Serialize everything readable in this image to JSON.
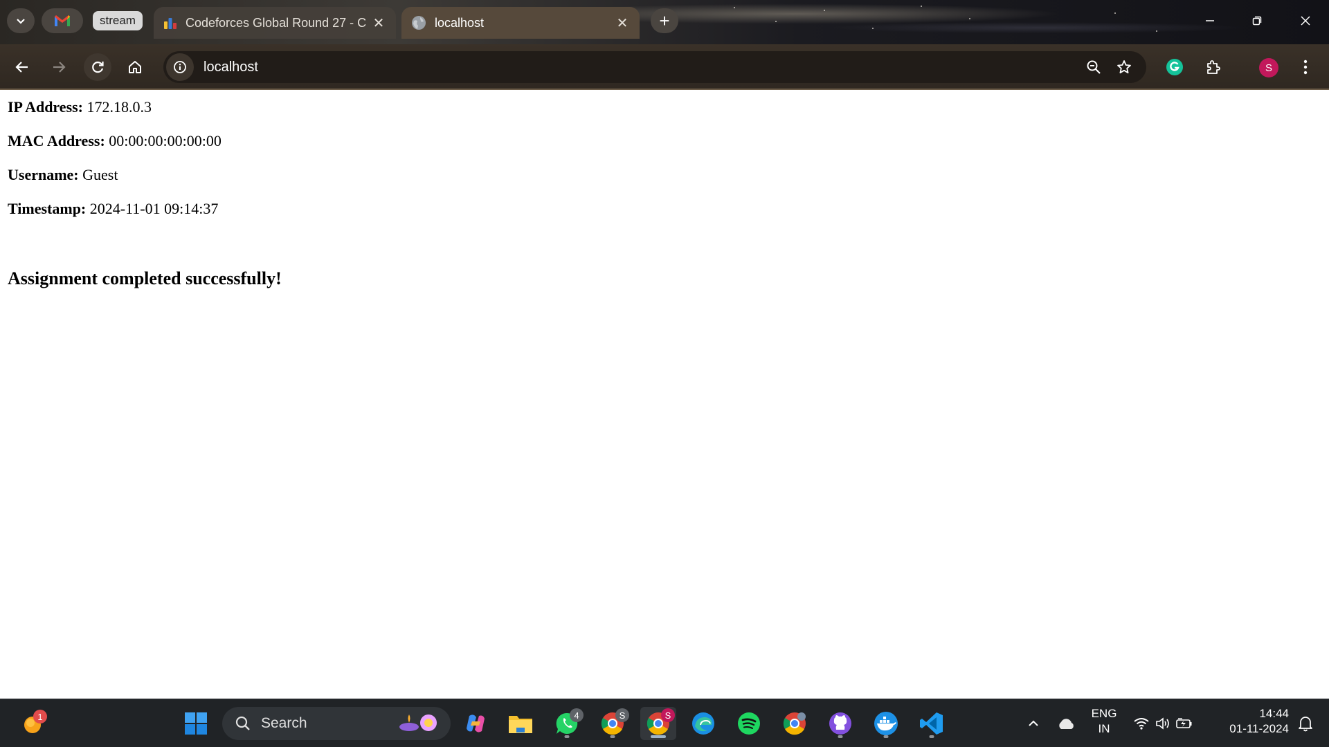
{
  "browser": {
    "tab_group_label": "stream",
    "tabs": [
      {
        "title": "Codeforces Global Round 27 - C",
        "active": false
      },
      {
        "title": "localhost",
        "active": true
      }
    ],
    "address_bar": {
      "url": "localhost"
    },
    "profile_initial": "S"
  },
  "page": {
    "fields": [
      {
        "label": "IP Address:",
        "value": "172.18.0.3"
      },
      {
        "label": "MAC Address:",
        "value": "00:00:00:00:00:00"
      },
      {
        "label": "Username:",
        "value": "Guest"
      },
      {
        "label": "Timestamp:",
        "value": "2024-11-01 09:14:37"
      }
    ],
    "message": "Assignment completed successfully!"
  },
  "taskbar": {
    "widgets_badge": "1",
    "search_placeholder": "Search",
    "whatsapp_badge": "4",
    "chrome_profile_1": "S",
    "chrome_profile_2": "S",
    "language": "ENG",
    "region": "IN",
    "time": "14:44",
    "date": "01-11-2024"
  },
  "colors": {
    "profile": "#c2185b",
    "toolbar": "#3a3128",
    "taskbar": "#202326"
  }
}
